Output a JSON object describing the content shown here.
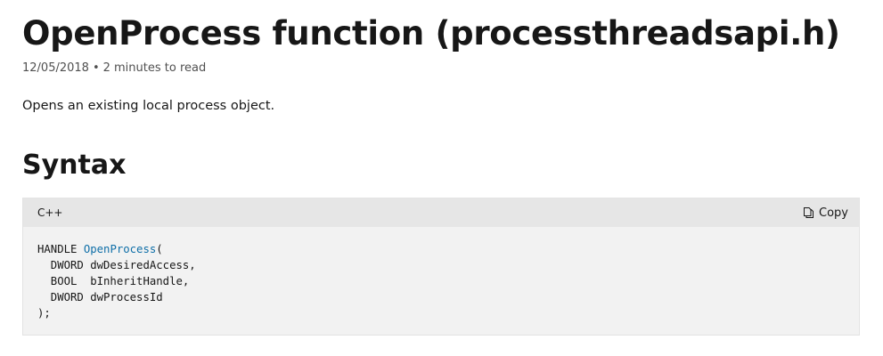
{
  "article": {
    "title": "OpenProcess function (processthreadsapi.h)",
    "date": "12/05/2018",
    "meta_separator": "•",
    "read_time": "2 minutes to read",
    "summary": "Opens an existing local process object."
  },
  "syntax": {
    "heading": "Syntax",
    "code_block": {
      "language": "C++",
      "copy_label": "Copy",
      "copy_icon": "copy-icon",
      "lines": {
        "l1_type": "HANDLE ",
        "l1_fn": "OpenProcess",
        "l1_paren": "(",
        "l2": "  DWORD dwDesiredAccess,",
        "l3": "  BOOL  bInheritHandle,",
        "l4": "  DWORD dwProcessId",
        "l5": ");"
      }
    }
  },
  "colors": {
    "function_name": "#0f6fa8",
    "code_background": "#f2f2f2",
    "code_header_background": "#e6e6e6"
  }
}
